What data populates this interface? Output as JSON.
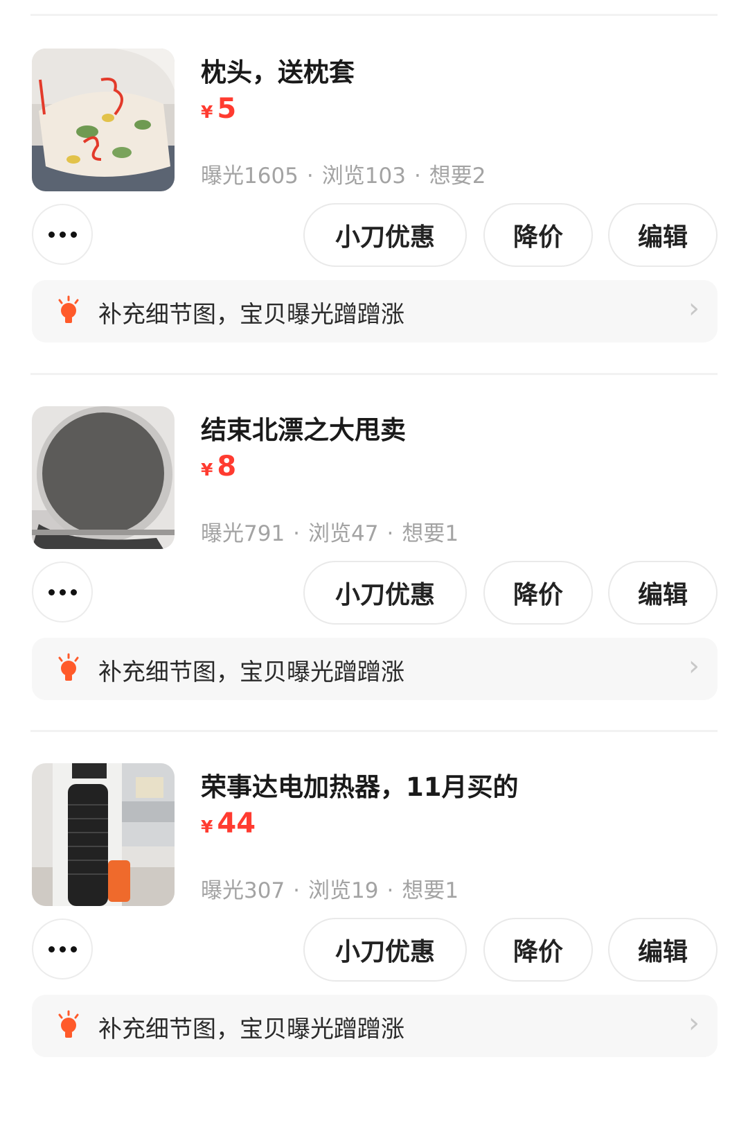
{
  "listings": [
    {
      "title": "枕头，送枕套",
      "currency": "¥",
      "price": "5",
      "stats": {
        "exposure": "曝光1605",
        "views": "浏览103",
        "wants": "想要2"
      },
      "actions": {
        "knife": "小刀优惠",
        "reduce": "降价",
        "edit": "编辑"
      },
      "tip": "补充细节图，宝贝曝光蹭蹭涨",
      "image": "pillow-photo"
    },
    {
      "title": "结束北漂之大甩卖",
      "currency": "¥",
      "price": "8",
      "stats": {
        "exposure": "曝光791",
        "views": "浏览47",
        "wants": "想要1"
      },
      "actions": {
        "knife": "小刀优惠",
        "reduce": "降价",
        "edit": "编辑"
      },
      "tip": "补充细节图，宝贝曝光蹭蹭涨",
      "image": "round-mirror-photo"
    },
    {
      "title": "荣事达电加热器，11月买的",
      "currency": "¥",
      "price": "44",
      "stats": {
        "exposure": "曝光307",
        "views": "浏览19",
        "wants": "想要1"
      },
      "actions": {
        "knife": "小刀优惠",
        "reduce": "降价",
        "edit": "编辑"
      },
      "tip": "补充细节图，宝贝曝光蹭蹭涨",
      "image": "heater-photo"
    }
  ],
  "colors": {
    "price": "#ff3b30",
    "tip_icon": "#ff5a2a",
    "muted": "#a3a3a3"
  },
  "icons": {
    "more": "more-dots-icon",
    "tip": "lightbulb-icon",
    "chevron": "chevron-right-icon"
  }
}
